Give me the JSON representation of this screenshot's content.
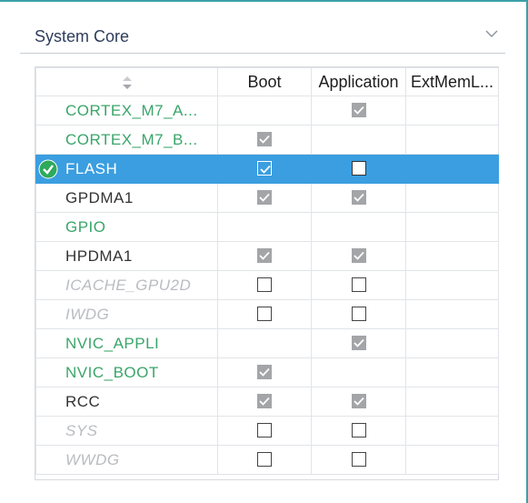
{
  "panel": {
    "title": "System Core"
  },
  "table": {
    "columns": [
      "",
      "Boot",
      "Application",
      "ExtMemL..."
    ],
    "rows": [
      {
        "name": "CORTEX_M7_A...",
        "style": "green",
        "boot": "none",
        "app": "checked-disabled",
        "ext": "none",
        "selected": false
      },
      {
        "name": "CORTEX_M7_B...",
        "style": "green",
        "boot": "checked-disabled",
        "app": "none",
        "ext": "none",
        "selected": false
      },
      {
        "name": "FLASH",
        "style": "selected",
        "boot": "checked",
        "app": "unchecked",
        "ext": "none",
        "selected": true
      },
      {
        "name": "GPDMA1",
        "style": "dark",
        "boot": "checked-disabled",
        "app": "checked-disabled",
        "ext": "none",
        "selected": false
      },
      {
        "name": "GPIO",
        "style": "green",
        "boot": "none",
        "app": "none",
        "ext": "none",
        "selected": false
      },
      {
        "name": "HPDMA1",
        "style": "dark",
        "boot": "checked-disabled",
        "app": "checked-disabled",
        "ext": "none",
        "selected": false
      },
      {
        "name": "ICACHE_GPU2D",
        "style": "gray",
        "boot": "unchecked",
        "app": "unchecked",
        "ext": "none",
        "selected": false
      },
      {
        "name": "IWDG",
        "style": "gray",
        "boot": "unchecked",
        "app": "unchecked",
        "ext": "none",
        "selected": false
      },
      {
        "name": "NVIC_APPLI",
        "style": "green",
        "boot": "none",
        "app": "checked-disabled",
        "ext": "none",
        "selected": false
      },
      {
        "name": "NVIC_BOOT",
        "style": "green",
        "boot": "checked-disabled",
        "app": "none",
        "ext": "none",
        "selected": false
      },
      {
        "name": "RCC",
        "style": "dark",
        "boot": "checked-disabled",
        "app": "checked-disabled",
        "ext": "none",
        "selected": false
      },
      {
        "name": "SYS",
        "style": "gray",
        "boot": "unchecked",
        "app": "unchecked",
        "ext": "none",
        "selected": false
      },
      {
        "name": "WWDG",
        "style": "gray",
        "boot": "unchecked",
        "app": "unchecked",
        "ext": "none",
        "selected": false
      }
    ]
  },
  "icons": {
    "header": "chevron-down-icon",
    "sort": "sort-icon",
    "selected_row": "check-circle-icon"
  },
  "colors": {
    "accent": "#3aa0a8",
    "selection": "#3a9ee0",
    "green_text": "#3aa56a",
    "gray_text": "#b9bcc1"
  }
}
